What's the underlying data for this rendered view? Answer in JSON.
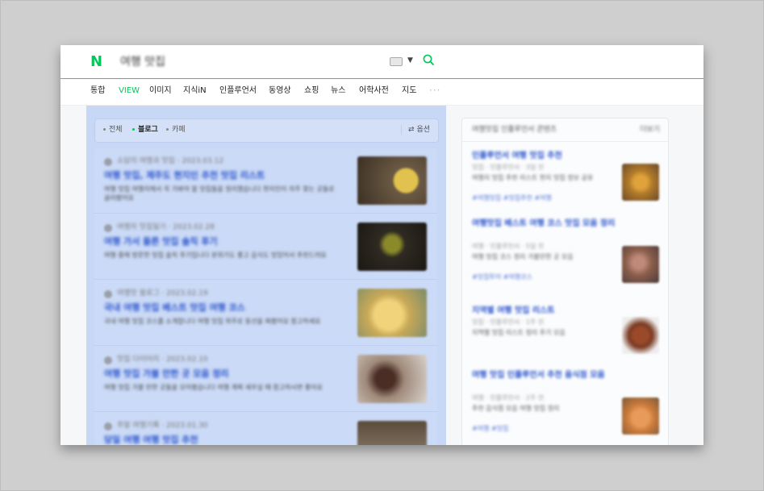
{
  "header": {
    "logo": "N",
    "query": "여행 맛집"
  },
  "tabs": [
    {
      "label": "통합"
    },
    {
      "label": "VIEW",
      "active": true
    },
    {
      "label": "이미지"
    },
    {
      "label": "지식iN"
    },
    {
      "label": "인플루언서"
    },
    {
      "label": "동영상"
    },
    {
      "label": "쇼핑"
    },
    {
      "label": "뉴스"
    },
    {
      "label": "어학사전"
    },
    {
      "label": "지도"
    }
  ],
  "more_tabs": "···",
  "subtabs": {
    "items": [
      {
        "label": "전체"
      },
      {
        "label": "블로그",
        "active": true
      },
      {
        "label": "카페"
      }
    ],
    "options": "옵션"
  },
  "results": [
    {
      "author": "소담의 여행과 맛집 · 2023.03.12",
      "title": "여행 맛집, 제주도 현지인 추천 맛집 리스트",
      "snippet": "여행 맛집 여행지에서 꼭 가봐야 할 맛집들을 정리했습니다 현지인이 자주 찾는 곳들로 골라봤어요",
      "thumb_color": "#6b5a44"
    },
    {
      "author": "여행자 맛집일기 · 2023.02.28",
      "title": "여행 가서 들른 맛집 솔직 후기",
      "snippet": "여행 중에 방문한 맛집 솔직 후기입니다 분위기도 좋고 음식도 맛있어서 추천드려요",
      "thumb_color": "#2f2a22"
    },
    {
      "author": "여행맛 블로그 · 2023.02.19",
      "title": "국내 여행 맛집 베스트 맛집 여행 코스",
      "snippet": "국내 여행 맛집 코스를 소개합니다 여행 맛집 위주로 동선을 짜봤어요 참고하세요",
      "thumb_color": "#c8a957"
    },
    {
      "author": "맛집 다이어리 · 2023.02.10",
      "title": "여행 맛집 가볼 만한 곳 모음 정리",
      "snippet": "여행 맛집 가볼 만한 곳들을 모아봤습니다 여행 계획 세우실 때 참고하시면 좋아요",
      "thumb_color": "#7a5a4a"
    },
    {
      "author": "주말 여행기록 · 2023.01.30",
      "title": "당일 여행 여행 맛집 추천",
      "snippet": "",
      "thumb_color": "#8a7a6a"
    }
  ],
  "right_panel": {
    "title": "여행맛집 인플루언서 콘텐츠",
    "more": "더보기",
    "items": [
      {
        "title": "인플루언서 여행 맛집 추천",
        "meta": "맛집 · 인플루언서 · 3일 전",
        "snippet": "여행지 맛집 추천 리스트 현지 맛집 정보 공유",
        "tags": "#여행맛집 #맛집추천 #여행",
        "thumb_color": "#b07a2a"
      },
      {
        "title": "여행맛집 베스트 여행 코스 맛집 모음 정리",
        "meta": "여행 · 인플루언서 · 5일 전",
        "snippet": "여행 맛집 코스 정리 가볼만한 곳 모음",
        "tags": "#맛집투어 #여행코스",
        "thumb_color": "#8b5e4b"
      },
      {
        "title": "지역별 여행 맛집 리스트",
        "meta": "맛집 · 인플루언서 · 1주 전",
        "snippet": "지역별 맛집 리스트 정리 후기 모음",
        "tags": "",
        "thumb_color": "#7a3a22"
      },
      {
        "title": "여행 맛집 인플루언서 추천 음식점 모음",
        "meta": "여행 · 인플루언서 · 2주 전",
        "snippet": "추천 음식점 모음 여행 맛집 정리",
        "tags": "#여행 #맛집",
        "thumb_color": "#c97a3a"
      }
    ]
  },
  "colors": {
    "brand_green": "#03c75a",
    "link_blue": "#2853cc",
    "highlight_blue": "#c7d8f7"
  }
}
